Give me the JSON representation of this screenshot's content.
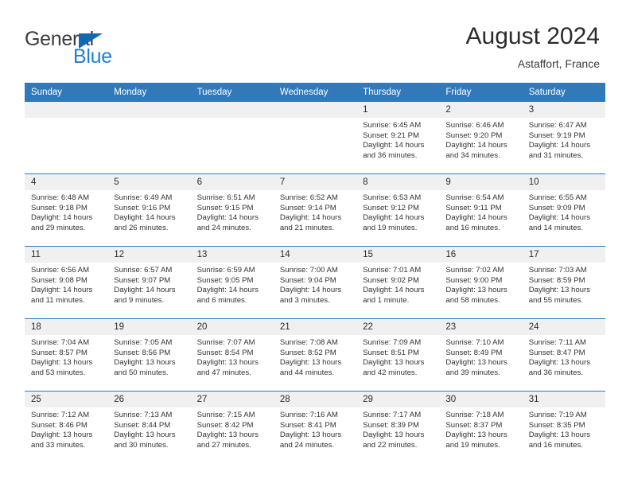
{
  "brand": {
    "name_top": "General",
    "name_bottom": "Blue"
  },
  "header": {
    "title": "August 2024",
    "subtitle": "Astaffort, France"
  },
  "calendar": {
    "weekday_headers": [
      "Sunday",
      "Monday",
      "Tuesday",
      "Wednesday",
      "Thursday",
      "Friday",
      "Saturday"
    ],
    "colors": {
      "header_blue": "#3279ba",
      "daynum_band": "#f0f0f0",
      "brand_blue": "#1f7fd0"
    },
    "weeks": [
      [
        {
          "day": "",
          "empty": true
        },
        {
          "day": "",
          "empty": true
        },
        {
          "day": "",
          "empty": true
        },
        {
          "day": "",
          "empty": true
        },
        {
          "day": "1",
          "sunrise": "Sunrise: 6:45 AM",
          "sunset": "Sunset: 9:21 PM",
          "daylight1": "Daylight: 14 hours",
          "daylight2": "and 36 minutes."
        },
        {
          "day": "2",
          "sunrise": "Sunrise: 6:46 AM",
          "sunset": "Sunset: 9:20 PM",
          "daylight1": "Daylight: 14 hours",
          "daylight2": "and 34 minutes."
        },
        {
          "day": "3",
          "sunrise": "Sunrise: 6:47 AM",
          "sunset": "Sunset: 9:19 PM",
          "daylight1": "Daylight: 14 hours",
          "daylight2": "and 31 minutes."
        }
      ],
      [
        {
          "day": "4",
          "sunrise": "Sunrise: 6:48 AM",
          "sunset": "Sunset: 9:18 PM",
          "daylight1": "Daylight: 14 hours",
          "daylight2": "and 29 minutes."
        },
        {
          "day": "5",
          "sunrise": "Sunrise: 6:49 AM",
          "sunset": "Sunset: 9:16 PM",
          "daylight1": "Daylight: 14 hours",
          "daylight2": "and 26 minutes."
        },
        {
          "day": "6",
          "sunrise": "Sunrise: 6:51 AM",
          "sunset": "Sunset: 9:15 PM",
          "daylight1": "Daylight: 14 hours",
          "daylight2": "and 24 minutes."
        },
        {
          "day": "7",
          "sunrise": "Sunrise: 6:52 AM",
          "sunset": "Sunset: 9:14 PM",
          "daylight1": "Daylight: 14 hours",
          "daylight2": "and 21 minutes."
        },
        {
          "day": "8",
          "sunrise": "Sunrise: 6:53 AM",
          "sunset": "Sunset: 9:12 PM",
          "daylight1": "Daylight: 14 hours",
          "daylight2": "and 19 minutes."
        },
        {
          "day": "9",
          "sunrise": "Sunrise: 6:54 AM",
          "sunset": "Sunset: 9:11 PM",
          "daylight1": "Daylight: 14 hours",
          "daylight2": "and 16 minutes."
        },
        {
          "day": "10",
          "sunrise": "Sunrise: 6:55 AM",
          "sunset": "Sunset: 9:09 PM",
          "daylight1": "Daylight: 14 hours",
          "daylight2": "and 14 minutes."
        }
      ],
      [
        {
          "day": "11",
          "sunrise": "Sunrise: 6:56 AM",
          "sunset": "Sunset: 9:08 PM",
          "daylight1": "Daylight: 14 hours",
          "daylight2": "and 11 minutes."
        },
        {
          "day": "12",
          "sunrise": "Sunrise: 6:57 AM",
          "sunset": "Sunset: 9:07 PM",
          "daylight1": "Daylight: 14 hours",
          "daylight2": "and 9 minutes."
        },
        {
          "day": "13",
          "sunrise": "Sunrise: 6:59 AM",
          "sunset": "Sunset: 9:05 PM",
          "daylight1": "Daylight: 14 hours",
          "daylight2": "and 6 minutes."
        },
        {
          "day": "14",
          "sunrise": "Sunrise: 7:00 AM",
          "sunset": "Sunset: 9:04 PM",
          "daylight1": "Daylight: 14 hours",
          "daylight2": "and 3 minutes."
        },
        {
          "day": "15",
          "sunrise": "Sunrise: 7:01 AM",
          "sunset": "Sunset: 9:02 PM",
          "daylight1": "Daylight: 14 hours",
          "daylight2": "and 1 minute."
        },
        {
          "day": "16",
          "sunrise": "Sunrise: 7:02 AM",
          "sunset": "Sunset: 9:00 PM",
          "daylight1": "Daylight: 13 hours",
          "daylight2": "and 58 minutes."
        },
        {
          "day": "17",
          "sunrise": "Sunrise: 7:03 AM",
          "sunset": "Sunset: 8:59 PM",
          "daylight1": "Daylight: 13 hours",
          "daylight2": "and 55 minutes."
        }
      ],
      [
        {
          "day": "18",
          "sunrise": "Sunrise: 7:04 AM",
          "sunset": "Sunset: 8:57 PM",
          "daylight1": "Daylight: 13 hours",
          "daylight2": "and 53 minutes."
        },
        {
          "day": "19",
          "sunrise": "Sunrise: 7:05 AM",
          "sunset": "Sunset: 8:56 PM",
          "daylight1": "Daylight: 13 hours",
          "daylight2": "and 50 minutes."
        },
        {
          "day": "20",
          "sunrise": "Sunrise: 7:07 AM",
          "sunset": "Sunset: 8:54 PM",
          "daylight1": "Daylight: 13 hours",
          "daylight2": "and 47 minutes."
        },
        {
          "day": "21",
          "sunrise": "Sunrise: 7:08 AM",
          "sunset": "Sunset: 8:52 PM",
          "daylight1": "Daylight: 13 hours",
          "daylight2": "and 44 minutes."
        },
        {
          "day": "22",
          "sunrise": "Sunrise: 7:09 AM",
          "sunset": "Sunset: 8:51 PM",
          "daylight1": "Daylight: 13 hours",
          "daylight2": "and 42 minutes."
        },
        {
          "day": "23",
          "sunrise": "Sunrise: 7:10 AM",
          "sunset": "Sunset: 8:49 PM",
          "daylight1": "Daylight: 13 hours",
          "daylight2": "and 39 minutes."
        },
        {
          "day": "24",
          "sunrise": "Sunrise: 7:11 AM",
          "sunset": "Sunset: 8:47 PM",
          "daylight1": "Daylight: 13 hours",
          "daylight2": "and 36 minutes."
        }
      ],
      [
        {
          "day": "25",
          "sunrise": "Sunrise: 7:12 AM",
          "sunset": "Sunset: 8:46 PM",
          "daylight1": "Daylight: 13 hours",
          "daylight2": "and 33 minutes."
        },
        {
          "day": "26",
          "sunrise": "Sunrise: 7:13 AM",
          "sunset": "Sunset: 8:44 PM",
          "daylight1": "Daylight: 13 hours",
          "daylight2": "and 30 minutes."
        },
        {
          "day": "27",
          "sunrise": "Sunrise: 7:15 AM",
          "sunset": "Sunset: 8:42 PM",
          "daylight1": "Daylight: 13 hours",
          "daylight2": "and 27 minutes."
        },
        {
          "day": "28",
          "sunrise": "Sunrise: 7:16 AM",
          "sunset": "Sunset: 8:41 PM",
          "daylight1": "Daylight: 13 hours",
          "daylight2": "and 24 minutes."
        },
        {
          "day": "29",
          "sunrise": "Sunrise: 7:17 AM",
          "sunset": "Sunset: 8:39 PM",
          "daylight1": "Daylight: 13 hours",
          "daylight2": "and 22 minutes."
        },
        {
          "day": "30",
          "sunrise": "Sunrise: 7:18 AM",
          "sunset": "Sunset: 8:37 PM",
          "daylight1": "Daylight: 13 hours",
          "daylight2": "and 19 minutes."
        },
        {
          "day": "31",
          "sunrise": "Sunrise: 7:19 AM",
          "sunset": "Sunset: 8:35 PM",
          "daylight1": "Daylight: 13 hours",
          "daylight2": "and 16 minutes."
        }
      ]
    ]
  }
}
